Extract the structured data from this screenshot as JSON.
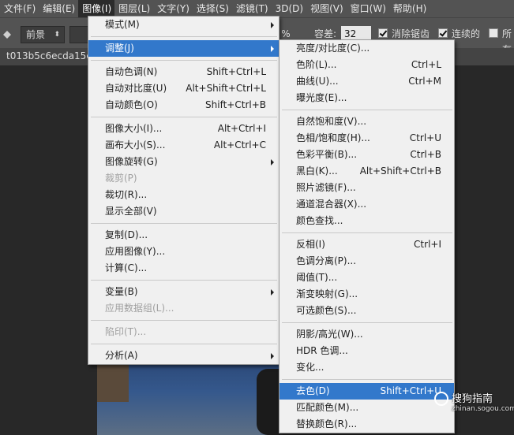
{
  "menubar": {
    "items": [
      {
        "label": "文件(F)"
      },
      {
        "label": "编辑(E)"
      },
      {
        "label": "图像(I)"
      },
      {
        "label": "图层(L)"
      },
      {
        "label": "文字(Y)"
      },
      {
        "label": "选择(S)"
      },
      {
        "label": "滤镜(T)"
      },
      {
        "label": "3D(D)"
      },
      {
        "label": "视图(V)"
      },
      {
        "label": "窗口(W)"
      },
      {
        "label": "帮助(H)"
      }
    ]
  },
  "options": {
    "mode_value": "前景",
    "percent_suffix": "%",
    "tolerance_label": "容差:",
    "tolerance_value": "32",
    "antialias_label": "消除锯齿",
    "contiguous_label": "连续的",
    "all_layers_label": "所有"
  },
  "document": {
    "tab_label": "t013b5c6ecda15d9"
  },
  "image_menu": {
    "items": [
      {
        "label": "模式(M)",
        "shortcut": ""
      },
      {
        "label": "调整(J)",
        "shortcut": ""
      },
      {
        "label": "自动色调(N)",
        "shortcut": "Shift+Ctrl+L"
      },
      {
        "label": "自动对比度(U)",
        "shortcut": "Alt+Shift+Ctrl+L"
      },
      {
        "label": "自动颜色(O)",
        "shortcut": "Shift+Ctrl+B"
      },
      {
        "label": "图像大小(I)...",
        "shortcut": "Alt+Ctrl+I"
      },
      {
        "label": "画布大小(S)...",
        "shortcut": "Alt+Ctrl+C"
      },
      {
        "label": "图像旋转(G)",
        "shortcut": ""
      },
      {
        "label": "裁剪(P)",
        "shortcut": ""
      },
      {
        "label": "裁切(R)...",
        "shortcut": ""
      },
      {
        "label": "显示全部(V)",
        "shortcut": ""
      },
      {
        "label": "复制(D)...",
        "shortcut": ""
      },
      {
        "label": "应用图像(Y)...",
        "shortcut": ""
      },
      {
        "label": "计算(C)...",
        "shortcut": ""
      },
      {
        "label": "变量(B)",
        "shortcut": ""
      },
      {
        "label": "应用数据组(L)...",
        "shortcut": ""
      },
      {
        "label": "陷印(T)...",
        "shortcut": ""
      },
      {
        "label": "分析(A)",
        "shortcut": ""
      }
    ]
  },
  "adjust_menu": {
    "items": [
      {
        "label": "亮度/对比度(C)...",
        "shortcut": ""
      },
      {
        "label": "色阶(L)...",
        "shortcut": "Ctrl+L"
      },
      {
        "label": "曲线(U)...",
        "shortcut": "Ctrl+M"
      },
      {
        "label": "曝光度(E)...",
        "shortcut": ""
      },
      {
        "label": "自然饱和度(V)...",
        "shortcut": ""
      },
      {
        "label": "色相/饱和度(H)...",
        "shortcut": "Ctrl+U"
      },
      {
        "label": "色彩平衡(B)...",
        "shortcut": "Ctrl+B"
      },
      {
        "label": "黑白(K)...",
        "shortcut": "Alt+Shift+Ctrl+B"
      },
      {
        "label": "照片滤镜(F)...",
        "shortcut": ""
      },
      {
        "label": "通道混合器(X)...",
        "shortcut": ""
      },
      {
        "label": "颜色查找...",
        "shortcut": ""
      },
      {
        "label": "反相(I)",
        "shortcut": "Ctrl+I"
      },
      {
        "label": "色调分离(P)...",
        "shortcut": ""
      },
      {
        "label": "阈值(T)...",
        "shortcut": ""
      },
      {
        "label": "渐变映射(G)...",
        "shortcut": ""
      },
      {
        "label": "可选颜色(S)...",
        "shortcut": ""
      },
      {
        "label": "阴影/高光(W)...",
        "shortcut": ""
      },
      {
        "label": "HDR 色调...",
        "shortcut": ""
      },
      {
        "label": "变化...",
        "shortcut": ""
      },
      {
        "label": "去色(D)",
        "shortcut": "Shift+Ctrl+U"
      },
      {
        "label": "匹配颜色(M)...",
        "shortcut": ""
      },
      {
        "label": "替换颜色(R)...",
        "shortcut": ""
      }
    ]
  },
  "watermark": {
    "text": "搜狗指南",
    "sub": "zhinan.sogou.com"
  },
  "colors": {
    "highlight": "#3278cb",
    "menu_bg": "#f0f0f0",
    "app_bg": "#535353"
  }
}
